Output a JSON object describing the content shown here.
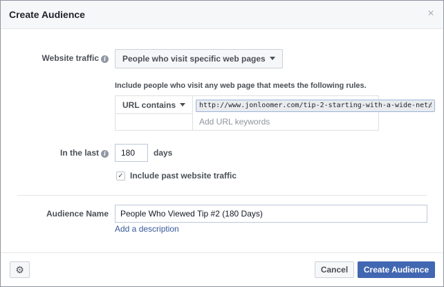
{
  "dialog": {
    "title": "Create Audience",
    "close_glyph": "×"
  },
  "website_traffic": {
    "label": "Website traffic",
    "info_glyph": "i",
    "selected": "People who visit specific web pages"
  },
  "rules": {
    "description": "Include people who visit any web page that meets the following rules.",
    "condition": "URL contains",
    "token_value": "http://www.jonloomer.com/tip-2-starting-with-a-wide-net/",
    "token_remove_glyph": "×",
    "placeholder": "Add URL keywords"
  },
  "in_the_last": {
    "label": "In the last",
    "info_glyph": "i",
    "value": "180",
    "unit": "days"
  },
  "past_traffic": {
    "label": "Include past website traffic",
    "checked": true,
    "check_glyph": "✓"
  },
  "audience_name": {
    "label": "Audience Name",
    "value": "People Who Viewed Tip #2 (180 Days)",
    "add_description": "Add a description"
  },
  "footer": {
    "gear_glyph": "⚙",
    "cancel_label": "Cancel",
    "create_label": "Create Audience"
  },
  "colors": {
    "primary": "#4267b2",
    "link": "#365899",
    "label": "#4b4f56"
  },
  "icons": [
    "info-icon",
    "caret-down-icon",
    "close-icon",
    "check-icon",
    "gear-icon"
  ]
}
